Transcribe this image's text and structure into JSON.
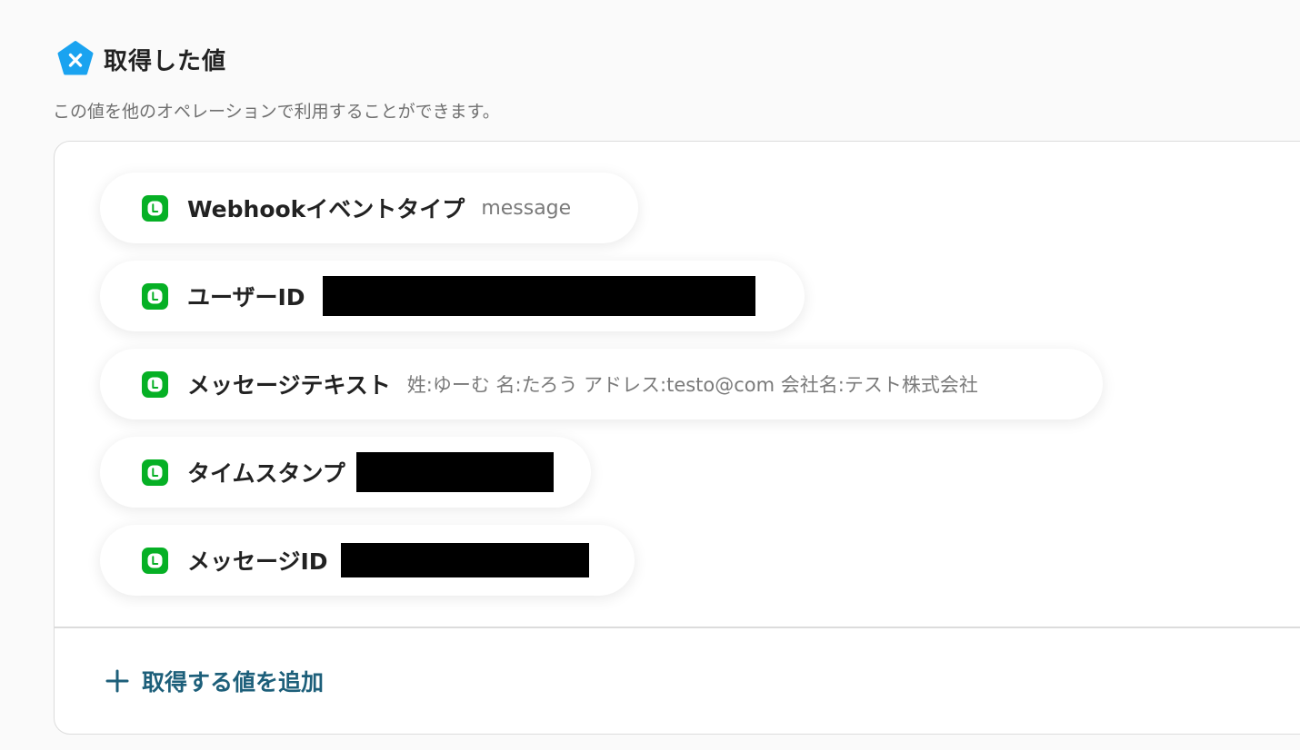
{
  "colors": {
    "brand_blue": "#1aa3f0",
    "line_green": "#06b025",
    "add_text": "#1d5f7a",
    "redaction": "#000000"
  },
  "header": {
    "icon": "pentagon-x-icon",
    "title": "取得した値",
    "description": "この値を他のオペレーションで利用することができます。"
  },
  "values": [
    {
      "icon": "line-icon",
      "label": "Webhookイベントタイプ",
      "value": "message",
      "redacted": false
    },
    {
      "icon": "line-icon",
      "label": "ユーザーID",
      "value": "",
      "redacted": true
    },
    {
      "icon": "line-icon",
      "label": "メッセージテキスト",
      "value": "姓:ゆーむ 名:たろう アドレス:testo@com 会社名:テスト株式会社",
      "redacted": false
    },
    {
      "icon": "line-icon",
      "label": "タイムスタンプ",
      "value": "",
      "redacted": true
    },
    {
      "icon": "line-icon",
      "label": "メッセージID",
      "value": "",
      "redacted": true
    }
  ],
  "add_button": {
    "icon": "plus-icon",
    "label": "取得する値を追加"
  }
}
